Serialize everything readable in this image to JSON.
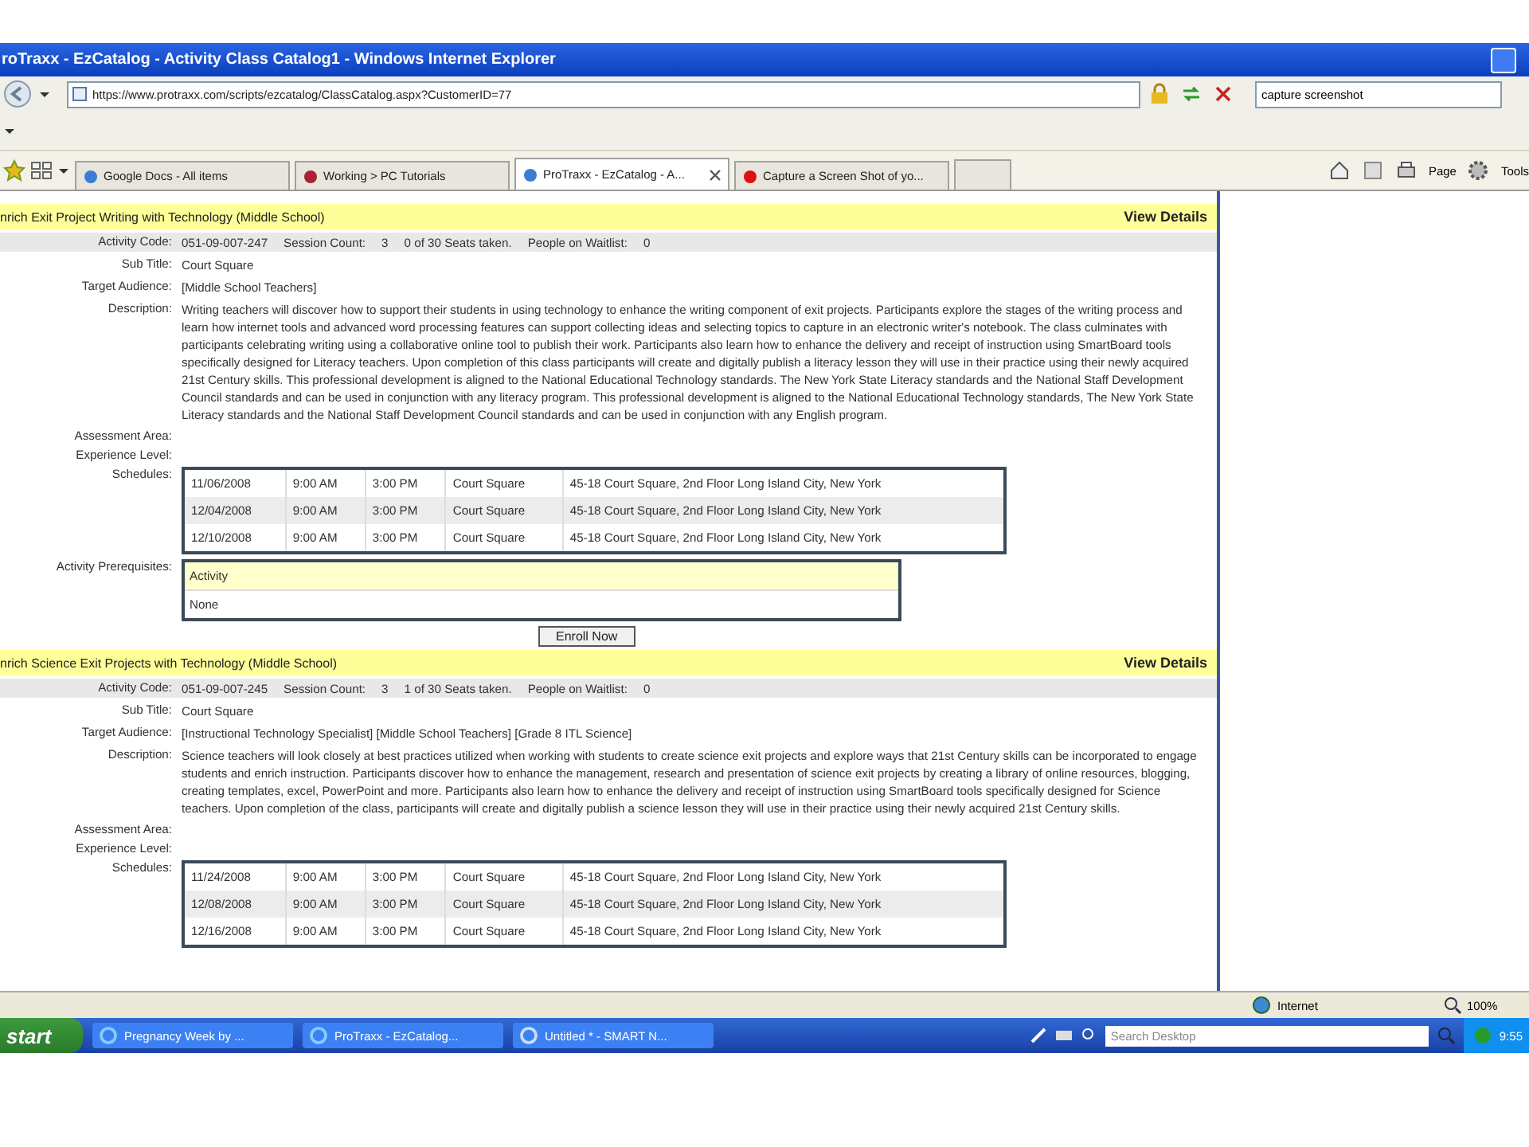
{
  "window": {
    "title": "roTraxx - EzCatalog - Activity Class Catalog1 - Windows Internet Explorer"
  },
  "address_bar": {
    "url": "https://www.protraxx.com/scripts/ezcatalog/ClassCatalog.aspx?CustomerID=77",
    "search_value": "capture screenshot"
  },
  "tabs": [
    {
      "label": "Google Docs - All items",
      "selected": false
    },
    {
      "label": "Working > PC Tutorials",
      "selected": false
    },
    {
      "label": "ProTraxx - EzCatalog - A...",
      "selected": true
    },
    {
      "label": "Capture a Screen Shot of yo...",
      "selected": false
    }
  ],
  "toolbar": {
    "page": "Page",
    "tools": "Tools"
  },
  "courses": [
    {
      "title": "nrich Exit Project Writing with Technology (Middle School)",
      "view_details": "View Details",
      "activity_code_label": "Activity Code:",
      "activity_code": "051-09-007-247",
      "session_count_label": "Session Count:",
      "session_count": "3",
      "seats": "0 of 30 Seats taken.",
      "waitlist_label": "People on Waitlist:",
      "waitlist": "0",
      "rows": [
        {
          "label": "Sub Title:",
          "value": "Court Square"
        },
        {
          "label": "Target Audience:",
          "value": "[Middle School Teachers]"
        },
        {
          "label": "Description:",
          "value": "Writing teachers will discover how to support their students in using technology to enhance the writing component of exit projects. Participants explore the stages of the writing process and learn how internet tools and advanced word processing features can support collecting ideas and selecting topics to capture in an electronic writer's notebook. The class culminates with participants celebrating writing using a collaborative online tool to publish their work. Participants also learn how to enhance the delivery and receipt of instruction using SmartBoard tools specifically designed for Literacy teachers. Upon completion of this class participants will create and digitally publish a literacy lesson they will use in their practice using their newly acquired 21st Century skills. This professional development is aligned to the National Educational Technology standards. The New York State Literacy standards and the National Staff Development Council standards and can be used in conjunction with any literacy program. This professional development is aligned to the National Educational Technology standards, The New York State Literacy standards and the National Staff Development Council standards and can be used in conjunction with any English program."
        },
        {
          "label": "Assessment Area:"
        },
        {
          "label": "Experience Level:"
        }
      ],
      "schedules_label": "Schedules:",
      "schedules": [
        [
          "11/06/2008",
          "9:00 AM",
          "3:00 PM",
          "Court Square",
          "45-18 Court Square, 2nd Floor Long Island City, New York"
        ],
        [
          "12/04/2008",
          "9:00 AM",
          "3:00 PM",
          "Court Square",
          "45-18 Court Square, 2nd Floor Long Island City, New York"
        ],
        [
          "12/10/2008",
          "9:00 AM",
          "3:00 PM",
          "Court Square",
          "45-18 Court Square, 2nd Floor Long Island City, New York"
        ]
      ],
      "prerequisites": {
        "label": "Activity Prerequisites:",
        "header": "Activity",
        "rows": [
          "None"
        ]
      },
      "enroll_button": "Enroll Now"
    },
    {
      "title": "nrich Science Exit Projects with Technology (Middle School)",
      "view_details": "View Details",
      "activity_code_label": "Activity Code:",
      "activity_code": "051-09-007-245",
      "session_count_label": "Session Count:",
      "session_count": "3",
      "seats": "1 of 30 Seats taken.",
      "waitlist_label": "People on Waitlist:",
      "waitlist": "0",
      "rows": [
        {
          "label": "Sub Title:",
          "value": "Court Square"
        },
        {
          "label": "Target Audience:",
          "value": "[Instructional Technology Specialist] [Middle School Teachers] [Grade 8 ITL Science]"
        },
        {
          "label": "Description:",
          "value": "Science teachers will look closely at best practices utilized when working with students to create science exit projects and explore ways that 21st Century skills can be incorporated to engage students and enrich instruction. Participants discover how to enhance the management, research and presentation of science exit projects by creating a library of online resources, blogging, creating templates, excel, PowerPoint and more. Participants also learn how to enhance the delivery and receipt of instruction using SmartBoard tools specifically designed for Science teachers. Upon completion of the class, participants will create and digitally publish a science lesson they will use in their practice using their newly acquired 21st Century skills."
        },
        {
          "label": "Assessment Area:"
        },
        {
          "label": "Experience Level:"
        }
      ],
      "schedules_label": "Schedules:",
      "schedules": [
        [
          "11/24/2008",
          "9:00 AM",
          "3:00 PM",
          "Court Square",
          "45-18 Court Square, 2nd Floor Long Island City, New York"
        ],
        [
          "12/08/2008",
          "9:00 AM",
          "3:00 PM",
          "Court Square",
          "45-18 Court Square, 2nd Floor Long Island City, New York"
        ],
        [
          "12/16/2008",
          "9:00 AM",
          "3:00 PM",
          "Court Square",
          "45-18 Court Square, 2nd Floor Long Island City, New York"
        ]
      ]
    }
  ],
  "status_bar": {
    "zone": "Internet",
    "zoom": "100%"
  },
  "taskbar": {
    "start": "start",
    "buttons": [
      "Pregnancy Week by ...",
      "ProTraxx - EzCatalog...",
      "Untitled * - SMART N..."
    ],
    "search_placeholder": "Search Desktop",
    "clock": "9:55"
  }
}
